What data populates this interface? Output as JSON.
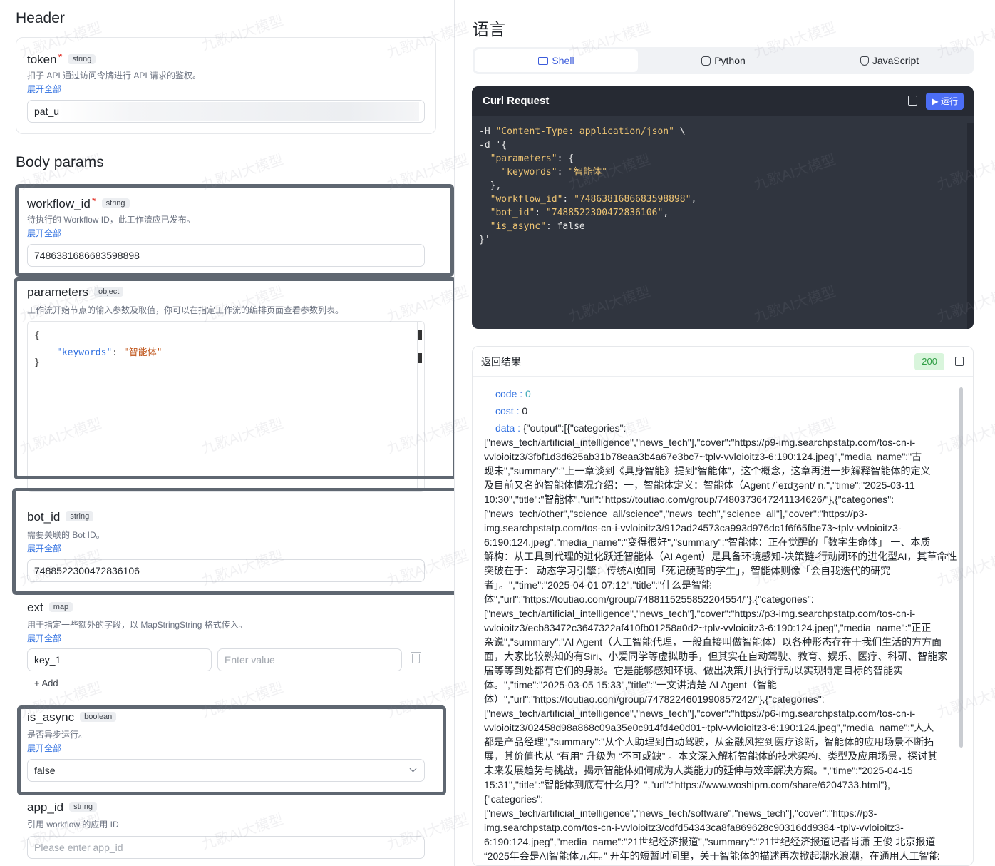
{
  "left": {
    "header_title": "Header",
    "body_title": "Body params",
    "expand_label": "展开全部",
    "add_label": "+ Add",
    "params": {
      "token": {
        "name": "token",
        "type": "string",
        "required": "*",
        "desc": "扣子 API 通过访问令牌进行 API 请求的鉴权。",
        "value": "pat_u"
      },
      "workflow_id": {
        "name": "workflow_id",
        "type": "string",
        "required": "*",
        "desc": "待执行的 Workflow ID，此工作流应已发布。",
        "value": "7486381686683598898"
      },
      "parameters": {
        "name": "parameters",
        "type": "object",
        "desc": "工作流开始节点的输入参数及取值，你可以在指定工作流的编排页面查看参数列表。",
        "brace_open": "{",
        "key": "\"keywords\"",
        "colon": ": ",
        "val": "\"智能体\"",
        "brace_close": "}"
      },
      "bot_id": {
        "name": "bot_id",
        "type": "string",
        "desc": "需要关联的 Bot ID。",
        "value": "7488522300472836106"
      },
      "ext": {
        "name": "ext",
        "type": "map",
        "desc": "用于指定一些额外的字段，以 MapStringString 格式传入。",
        "key_value": "key_1",
        "value_placeholder": "Enter value"
      },
      "is_async": {
        "name": "is_async",
        "type": "boolean",
        "desc": "是否异步运行。",
        "value": "false"
      },
      "app_id": {
        "name": "app_id",
        "type": "string",
        "desc": "引用 workflow 的应用 ID",
        "placeholder": "Please enter app_id"
      }
    }
  },
  "right": {
    "lang_title": "语言",
    "tabs": [
      {
        "label": "Shell",
        "icon": "terminal-icon"
      },
      {
        "label": "Python",
        "icon": "python-icon"
      },
      {
        "label": "JavaScript",
        "icon": "javascript-icon"
      }
    ],
    "curl_title": "Curl Request",
    "run_label": "▶ 运行",
    "code_lines": [
      "-H \"Content-Type: application/json\" \\",
      "-d '{",
      "  \"parameters\": {",
      "    \"keywords\": \"智能体\"",
      "  },",
      "  \"workflow_id\": \"7486381686683598898\",",
      "  \"bot_id\": \"7488522300472836106\",",
      "  \"is_async\": false",
      "}'"
    ],
    "result_title": "返回结果",
    "status_code": "200",
    "res_code_key": "code",
    "res_code_val": "0",
    "res_cost_key": "cost",
    "res_cost_val": "0",
    "res_data_key": "data",
    "res_data_lines": [
      "{\"output\":[{\"categories\":",
      "[\"news_tech/artificial_intelligence\",\"news_tech\"],\"cover\":\"https://p9-img.searchpstatp.com/tos-cn-i-",
      "vvloioitz3/3fbf1d3d625ab31b78eaa3b4a67e3bc7~tplv-vvloioitz3-6:190:124.jpeg\",\"media_name\":\"古",
      "现未\",\"summary\":\"上一章谈到《具身智能》提到“智能体”，这个概念，这章再进一步解释智能体的定义",
      "及目前又名的智能体情况介绍：一，智能体定义：智能体（Agent /ˈeɪdʒənt/ n.\",\"time\":\"2025-03-11",
      "10:30\",\"title\":\"智能体\",\"url\":\"https://toutiao.com/group/7480373647241134626/\"},{\"categories\":",
      "[\"news_tech/other\",\"science_all/science\",\"news_tech\",\"science_all\"],\"cover\":\"https://p3-",
      "img.searchpstatp.com/tos-cn-i-vvloioitz3/912ad24573ca993d976dc1f6f65fbe73~tplv-vvloioitz3-",
      "6:190:124.jpeg\",\"media_name\":\"变得很好\",\"summary\":\"智能体：正在觉醒的「数字生命体」 一、本质",
      "解构：从工具到代理的进化跃迁智能体（AI Agent）是具备环境感知-决策链-行动闭环的进化型AI，其革命性",
      "突破在于： 动态学习引擎：传统AI如同「死记硬背的学生」，智能体则像「会自我迭代的研究",
      "者」。\",\"time\":\"2025-04-01 07:12\",\"title\":\"什么是智能",
      "体\",\"url\":\"https://toutiao.com/group/7488115255852204554/\"},{\"categories\":",
      "[\"news_tech/artificial_intelligence\",\"news_tech\"],\"cover\":\"https://p3-img.searchpstatp.com/tos-cn-i-",
      "vvloioitz3/ecb83472c3647322af410fb01258a0d2~tplv-vvloioitz3-6:190:124.jpeg\",\"media_name\":\"正正",
      "杂说\",\"summary\":\"AI Agent（人工智能代理，一般直接叫做智能体）以各种形态存在于我们生活的方方面",
      "面，大家比较熟知的有Siri、小爱同学等虚拟助手，但其实在自动驾驶、教育、娱乐、医疗、科研、智能家",
      "居等等到处都有它们的身影。它是能够感知环境、做出决策并执行行动以实现特定目标的智能实",
      "体。\",\"time\":\"2025-03-05 15:33\",\"title\":\"一文讲清楚 AI Agent（智能",
      "体）\",\"url\":\"https://toutiao.com/group/7478224601990857242/\"},{\"categories\":",
      "[\"news_tech/artificial_intelligence\",\"news_tech\"],\"cover\":\"https://p6-img.searchpstatp.com/tos-cn-i-",
      "vvloioitz3/02458d98a868c09a35e0c914fd4e0d01~tplv-vvloioitz3-6:190:124.jpeg\",\"media_name\":\"人人",
      "都是产品经理\",\"summary\":\"从个人助理到自动驾驶，从金融风控到医疗诊断，智能体的应用场景不断拓",
      "展，其价值也从 “有用” 升级为 “不可或缺” 。本文深入解析智能体的技术架构、类型及应用场景，探讨其",
      "未来发展趋势与挑战，揭示智能体如何成为人类能力的延伸与效率解决方案。\",\"time\":\"2025-04-15",
      "15:31\",\"title\":\"智能体到底有什么用？\",\"url\":\"https://www.woshipm.com/share/6204733.html\"},",
      "{\"categories\":",
      "[\"news_tech/artificial_intelligence\",\"news_tech/software\",\"news_tech\"],\"cover\":\"https://p3-",
      "img.searchpstatp.com/tos-cn-i-vvloioitz3/cdfd54343ca8fa869628c90316dd9384~tplv-vvloioitz3-",
      "6:190:124.jpeg\",\"media_name\":\"21世纪经济报道\",\"summary\":\"21世纪经济报道记者肖潇 王俊 北京报道",
      "“2025年会是AI智能体元年。” 开年的短暂时间里，关于智能体的描述再次掀起潮水浪潮，在通用人工智能"
    ],
    "watermark": "九歌AI大模型"
  }
}
